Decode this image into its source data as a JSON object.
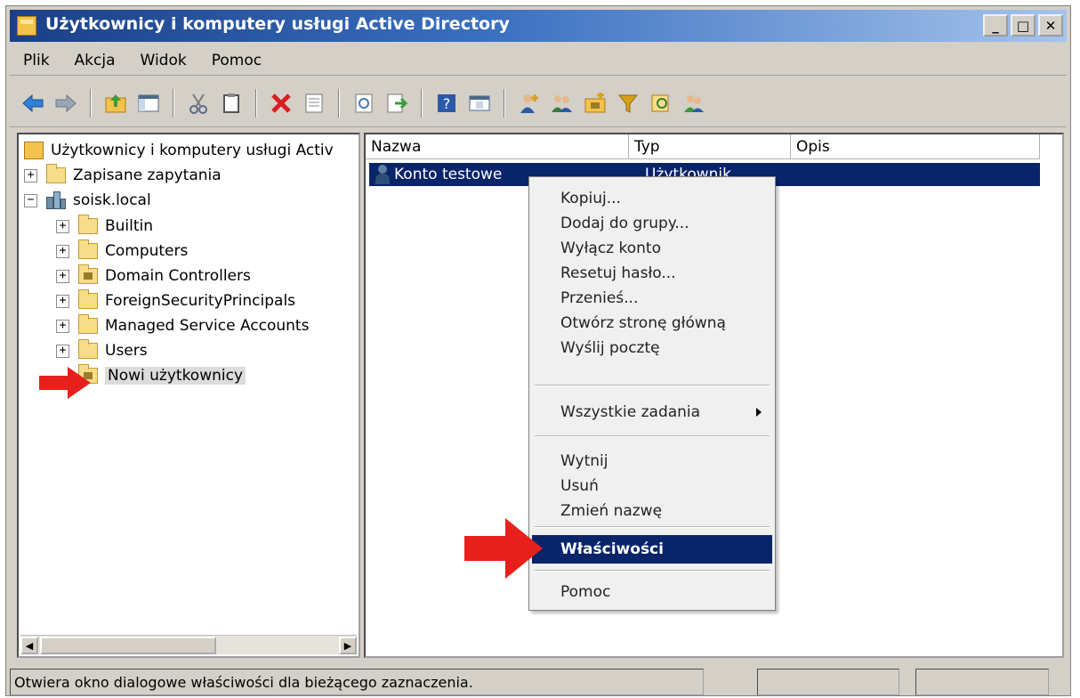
{
  "window": {
    "title": "Użytkownicy i komputery usługi Active Directory",
    "minimize": "_",
    "maximize": "□",
    "close": "✕"
  },
  "menu": [
    "Plik",
    "Akcja",
    "Widok",
    "Pomoc"
  ],
  "toolbar_icons": [
    "back-icon",
    "forward-icon",
    "up-folder-icon",
    "console-tree-icon",
    "cut-icon",
    "copy-icon",
    "delete-icon",
    "properties-icon",
    "refresh-icon",
    "export-icon",
    "help-icon",
    "details-view-icon",
    "new-user-icon",
    "new-group-icon",
    "new-ou-icon",
    "filter-icon",
    "find-icon",
    "add-to-group-icon"
  ],
  "tree": {
    "root": "Użytkownicy i komputery usługi Activ",
    "saved_queries": "Zapisane zapytania",
    "domain": "soisk.local",
    "children": [
      "Builtin",
      "Computers",
      "Domain Controllers",
      "ForeignSecurityPrincipals",
      "Managed Service Accounts",
      "Users",
      "Nowi użytkownicy"
    ]
  },
  "list": {
    "columns": [
      "Nazwa",
      "Typ",
      "Opis"
    ],
    "rows": [
      {
        "name": "Konto testowe",
        "type": "Użytkownik",
        "description": ""
      }
    ]
  },
  "context_menu": {
    "group1": [
      "Kopiuj...",
      "Dodaj do grupy...",
      "Wyłącz konto",
      "Resetuj hasło...",
      "Przenieś...",
      "Otwórz stronę główną",
      "Wyślij pocztę"
    ],
    "all_tasks": "Wszystkie zadania",
    "group3": [
      "Wytnij",
      "Usuń",
      "Zmień nazwę"
    ],
    "properties": "Właściwości",
    "help": "Pomoc"
  },
  "status": {
    "text": "Otwiera okno dialogowe właściwości dla bieżącego zaznaczenia."
  },
  "colors": {
    "selection": "#0a246a",
    "annotation_arrow": "#e8201c"
  }
}
